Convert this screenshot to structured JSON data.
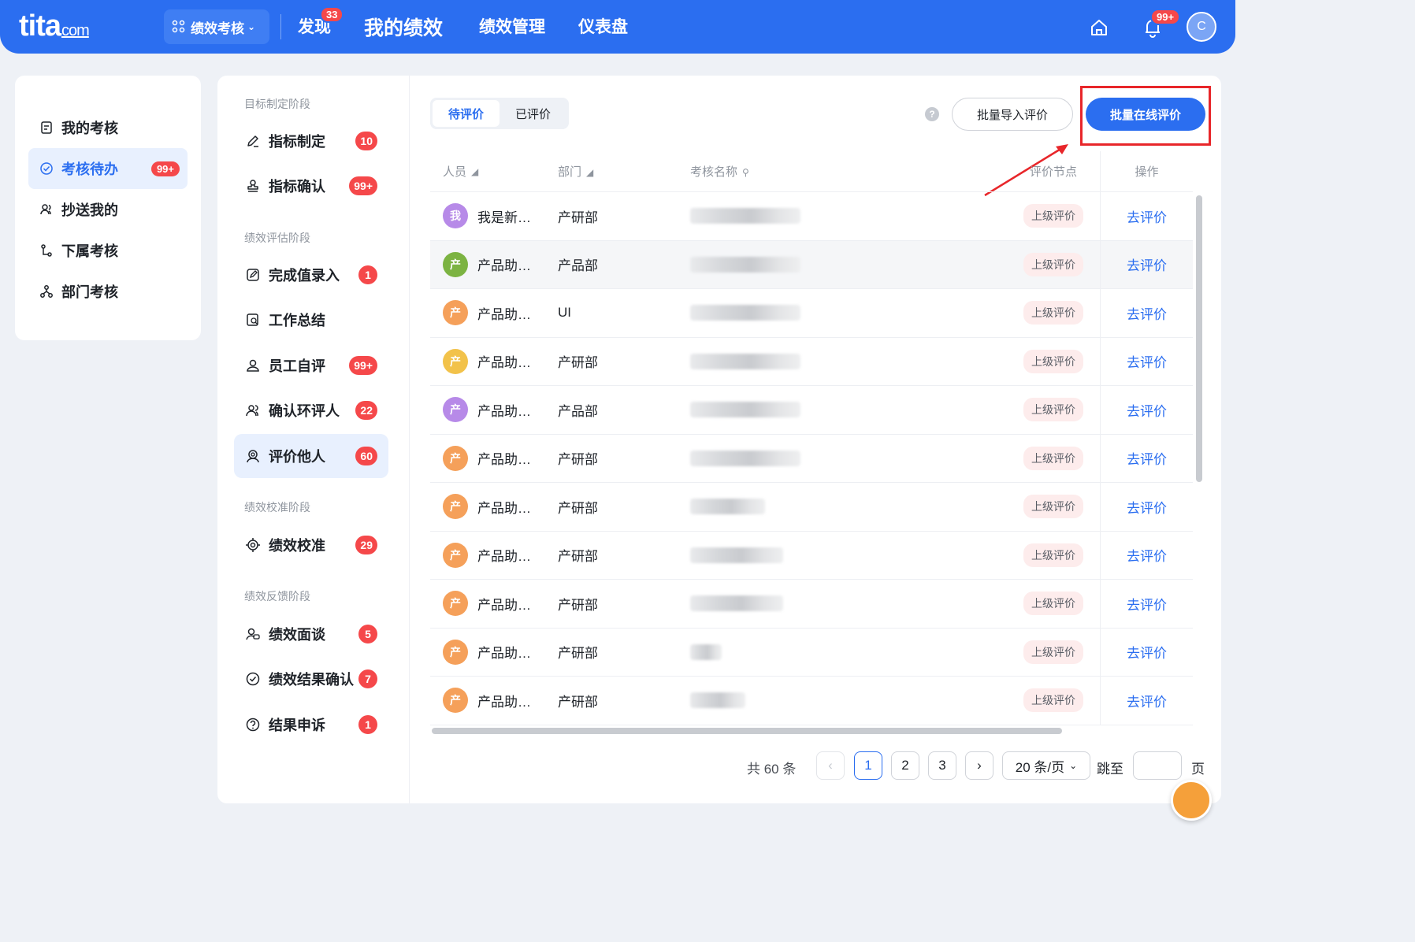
{
  "header": {
    "logo_main": "tita",
    "logo_suffix": "com",
    "module": "绩效考核",
    "nav": [
      {
        "label": "发现",
        "badge": "33"
      },
      {
        "label": "我的绩效"
      },
      {
        "label": "绩效管理"
      },
      {
        "label": "仪表盘"
      }
    ],
    "notification_badge": "99+",
    "avatar_letter": "C"
  },
  "sidebar": {
    "items": [
      {
        "label": "我的考核",
        "icon": "clipboard-icon"
      },
      {
        "label": "考核待办",
        "icon": "check-circle-icon",
        "badge": "99+",
        "active": true
      },
      {
        "label": "抄送我的",
        "icon": "users-icon"
      },
      {
        "label": "下属考核",
        "icon": "org-icon"
      },
      {
        "label": "部门考核",
        "icon": "department-icon"
      }
    ]
  },
  "stages": {
    "groups": [
      {
        "title": "目标制定阶段",
        "items": [
          {
            "label": "指标制定",
            "badge": "10",
            "icon": "pen-icon"
          },
          {
            "label": "指标确认",
            "badge": "99+",
            "icon": "stamp-icon"
          }
        ]
      },
      {
        "title": "绩效评估阶段",
        "items": [
          {
            "label": "完成值录入",
            "badge": "1",
            "icon": "edit-icon"
          },
          {
            "label": "工作总结",
            "icon": "summary-icon"
          },
          {
            "label": "员工自评",
            "badge": "99+",
            "icon": "person-icon"
          },
          {
            "label": "确认环评人",
            "badge": "22",
            "icon": "group-icon"
          },
          {
            "label": "评价他人",
            "badge": "60",
            "icon": "review-others-icon",
            "active": true
          }
        ]
      },
      {
        "title": "绩效校准阶段",
        "items": [
          {
            "label": "绩效校准",
            "badge": "29",
            "icon": "target-icon"
          }
        ]
      },
      {
        "title": "绩效反馈阶段",
        "items": [
          {
            "label": "绩效面谈",
            "badge": "5",
            "icon": "interview-icon"
          },
          {
            "label": "绩效结果确认",
            "badge": "7",
            "icon": "check-icon"
          },
          {
            "label": "结果申诉",
            "badge": "1",
            "icon": "question-icon"
          }
        ]
      }
    ]
  },
  "tabs": [
    {
      "label": "待评价",
      "active": true
    },
    {
      "label": "已评价"
    }
  ],
  "actions": {
    "help": "?",
    "import_label": "批量导入评价",
    "online_label": "批量在线评价"
  },
  "table": {
    "columns": {
      "person": "人员",
      "dept": "部门",
      "name": "考核名称",
      "node": "评价节点",
      "op": "操作"
    },
    "rows": [
      {
        "avatar": "我",
        "color": "#b78ae8",
        "name": "我是新…",
        "dept": "产研部",
        "node": "上级评价",
        "op": "去评价"
      },
      {
        "avatar": "产",
        "color": "#7cb342",
        "name": "产品助…",
        "dept": "产品部",
        "node": "上级评价",
        "op": "去评价"
      },
      {
        "avatar": "产",
        "color": "#f5a05a",
        "name": "产品助…",
        "dept": "UI",
        "node": "上级评价",
        "op": "去评价"
      },
      {
        "avatar": "产",
        "color": "#f2c24a",
        "name": "产品助…",
        "dept": "产研部",
        "node": "上级评价",
        "op": "去评价"
      },
      {
        "avatar": "产",
        "color": "#b78ae8",
        "name": "产品助…",
        "dept": "产品部",
        "node": "上级评价",
        "op": "去评价"
      },
      {
        "avatar": "产",
        "color": "#f5a05a",
        "name": "产品助…",
        "dept": "产研部",
        "node": "上级评价",
        "op": "去评价"
      },
      {
        "avatar": "产",
        "color": "#f5a05a",
        "name": "产品助…",
        "dept": "产研部",
        "node": "上级评价",
        "op": "去评价"
      },
      {
        "avatar": "产",
        "color": "#f5a05a",
        "name": "产品助…",
        "dept": "产研部",
        "node": "上级评价",
        "op": "去评价"
      },
      {
        "avatar": "产",
        "color": "#f5a05a",
        "name": "产品助…",
        "dept": "产研部",
        "node": "上级评价",
        "op": "去评价"
      },
      {
        "avatar": "产",
        "color": "#f5a05a",
        "name": "产品助…",
        "dept": "产研部",
        "node": "上级评价",
        "op": "去评价"
      },
      {
        "avatar": "产",
        "color": "#f5a05a",
        "name": "产品助…",
        "dept": "产研部",
        "node": "上级评价",
        "op": "去评价"
      }
    ]
  },
  "pagination": {
    "total": "共 60 条",
    "pages": [
      "1",
      "2",
      "3"
    ],
    "current": "1",
    "page_size": "20 条/页",
    "jump_label": "跳至",
    "page_suffix": "页"
  },
  "colors": {
    "brand": "#2b6ef0",
    "badge": "#f5484a",
    "highlight_frame": "#e8262a"
  }
}
